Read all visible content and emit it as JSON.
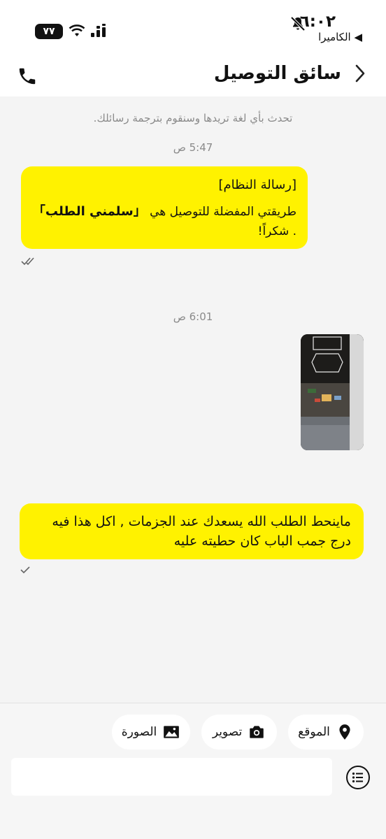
{
  "status_bar": {
    "time": "٦:٠٢",
    "carrier": "◀ الكاميرا",
    "battery": "٧٧"
  },
  "header": {
    "title": "سائق التوصيل"
  },
  "chat": {
    "hint": "تحدث بأي لغة تريدها وسنقوم بترجمة رسائلك.",
    "time1": "5:47 ص",
    "system_message": {
      "title": "[رسالة النظام]",
      "body_prefix": "طريقتي المفضلة للتوصيل هي",
      "highlight": "「سلمني الطلب」",
      "body_suffix": ". شكراً!"
    },
    "time2": "6:01 ص",
    "user_message": "ماينحط الطلب الله يسعدك عند الجزمات , اكل هذا فيه درج جمب الباب كان حطيته عليه"
  },
  "actions": {
    "location": "الموقع",
    "camera": "تصوير",
    "photo": "الصورة"
  },
  "input": {
    "placeholder": ""
  },
  "colors": {
    "accent_yellow": "#fff200",
    "background": "#f4f4f4"
  }
}
